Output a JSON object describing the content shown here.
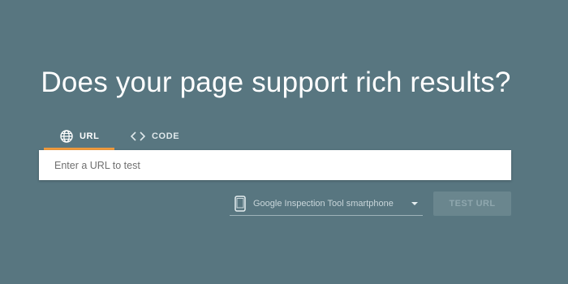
{
  "headline": "Does your page support rich results?",
  "tabs": [
    {
      "label": "URL",
      "icon": "globe-icon",
      "active": true
    },
    {
      "label": "CODE",
      "icon": "code-brackets-icon",
      "active": false
    }
  ],
  "url_input": {
    "placeholder": "Enter a URL to test",
    "value": ""
  },
  "crawler_select": {
    "icon": "smartphone-icon",
    "selected": "Google Inspection Tool smartphone"
  },
  "test_button": {
    "label": "TEST URL",
    "enabled": false
  },
  "colors": {
    "background": "#587680",
    "tab_indicator": "#f09a3c"
  }
}
